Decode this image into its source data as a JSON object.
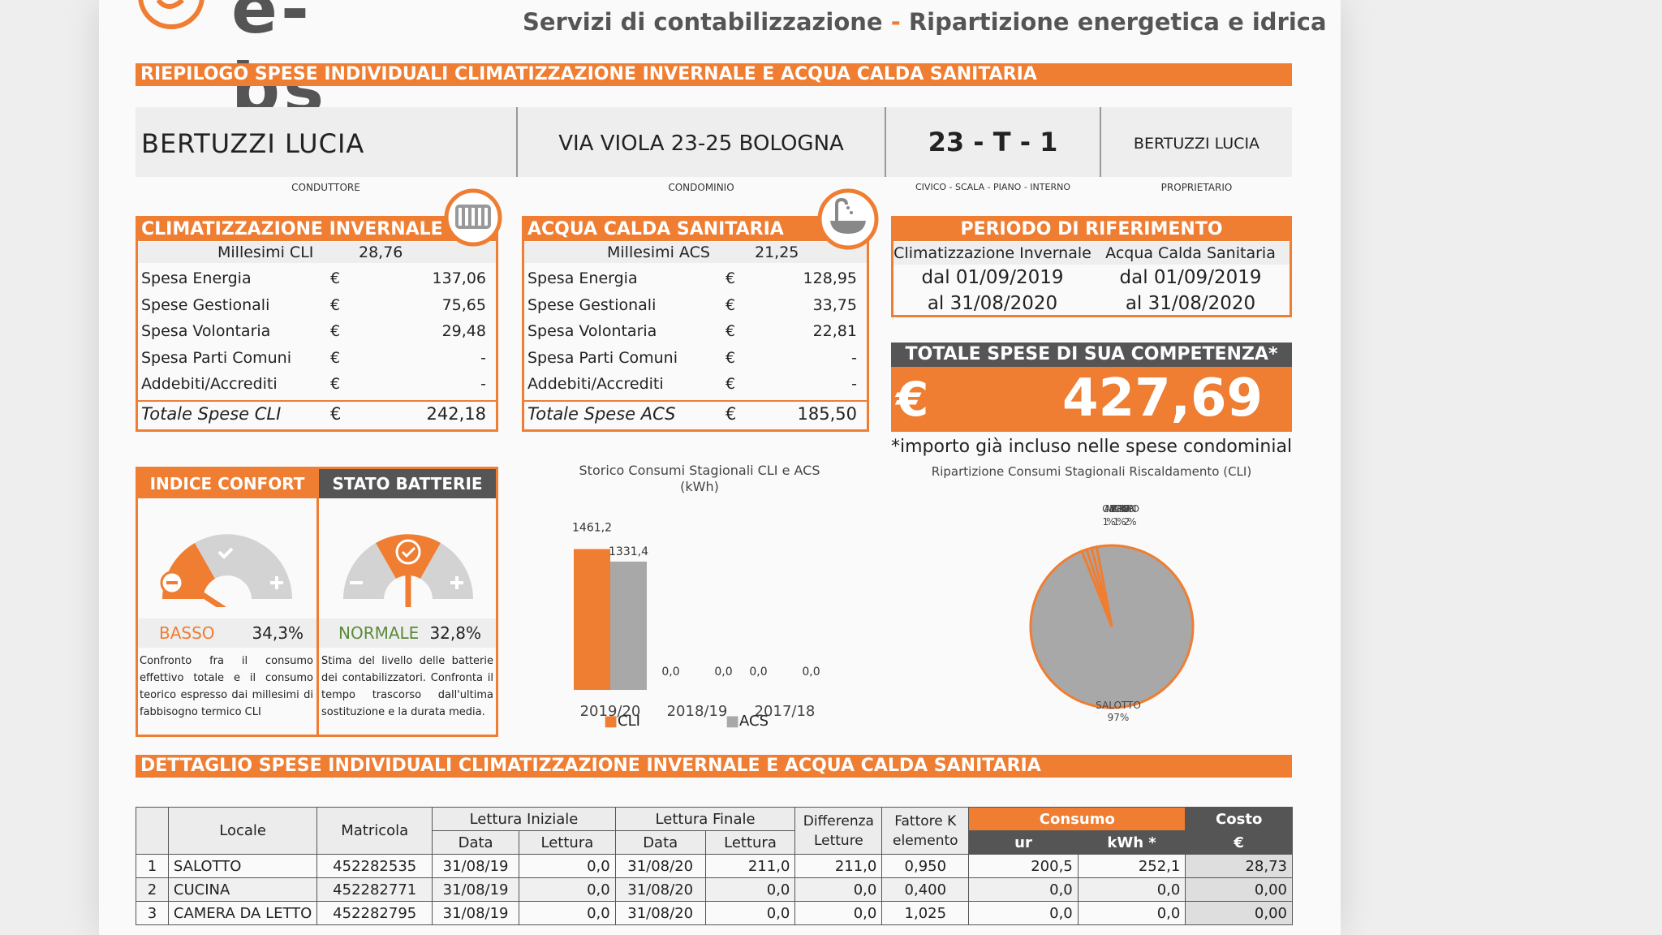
{
  "header": {
    "logo_text": "e-bs",
    "tagline_left": "Servizi di contabilizzazione",
    "tagline_sep": "-",
    "tagline_right": "Ripartizione energetica e idrica"
  },
  "summary_band": "RIEPILOGO SPESE INDIVIDUALI CLIMATIZZAZIONE INVERNALE E ACQUA CALDA SANITARIA",
  "info": {
    "tenant": "BERTUZZI LUCIA",
    "tenant_label": "CONDUTTORE",
    "condo": "VIA VIOLA 23-25 BOLOGNA",
    "condo_label": "CONDOMINIO",
    "unit": "23 - T - 1",
    "unit_label": "CIVICO - SCALA - PIANO - INTERNO",
    "owner": "BERTUZZI LUCIA",
    "owner_label": "PROPRIETARIO"
  },
  "cli": {
    "title": "CLIMATIZZAZIONE INVERNALE",
    "millesimi_label": "Millesimi CLI",
    "millesimi_value": "28,76",
    "rows": [
      {
        "label": "Spesa Energia",
        "cur": "€",
        "value": "137,06"
      },
      {
        "label": "Spese Gestionali",
        "cur": "€",
        "value": "75,65"
      },
      {
        "label": "Spesa Volontaria",
        "cur": "€",
        "value": "29,48"
      },
      {
        "label": "Spesa Parti Comuni",
        "cur": "€",
        "value": "-"
      },
      {
        "label": "Addebiti/Accrediti",
        "cur": "€",
        "value": "-"
      }
    ],
    "total_label": "Totale Spese CLI",
    "total_cur": "€",
    "total_value": "242,18"
  },
  "acs": {
    "title": "ACQUA CALDA SANITARIA",
    "millesimi_label": "Millesimi ACS",
    "millesimi_value": "21,25",
    "rows": [
      {
        "label": "Spesa Energia",
        "cur": "€",
        "value": "128,95"
      },
      {
        "label": "Spese Gestionali",
        "cur": "€",
        "value": "33,75"
      },
      {
        "label": "Spesa Volontaria",
        "cur": "€",
        "value": "22,81"
      },
      {
        "label": "Spesa Parti Comuni",
        "cur": "€",
        "value": "-"
      },
      {
        "label": "Addebiti/Accrediti",
        "cur": "€",
        "value": "-"
      }
    ],
    "total_label": "Totale Spese ACS",
    "total_cur": "€",
    "total_value": "185,50"
  },
  "period": {
    "title": "PERIODO DI RIFERIMENTO",
    "col1": "Climatizzazione Invernale",
    "col2": "Acqua Calda Sanitaria",
    "from1": "dal 01/09/2019",
    "from2": "dal 01/09/2019",
    "to1": "al 31/08/2020",
    "to2": "al 31/08/2020"
  },
  "total": {
    "title": "TOTALE SPESE DI SUA COMPETENZA*",
    "currency": "€",
    "value": "427,69",
    "note": "*importo già incluso nelle spese condominiali"
  },
  "confort": {
    "title": "INDICE CONFORT",
    "status": "BASSO",
    "percent": "34,3%",
    "description": "Confronto fra il consumo effettivo totale e il consumo teorico espresso dai millesimi di fabbisogno termico CLI",
    "status_color": "#ef7d32"
  },
  "batterie": {
    "title": "STATO BATTERIE",
    "status": "NORMALE",
    "percent": "32,8%",
    "description": "Stima del livello delle batterie dei contabilizzatori. Confronta il tempo trascorso dall'ultima sostituzione e la durata media.",
    "status_color": "#5b8a3a"
  },
  "colors": {
    "accent": "#ef7d32",
    "grey": "#a8a8a8",
    "dark": "#555555"
  },
  "icons": {
    "cli": "radiator-icon",
    "acs": "bathtub-icon"
  },
  "chart_data": [
    {
      "type": "bar",
      "title": "Storico Consumi Stagionali CLI e ACS",
      "subtitle": "(kWh)",
      "categories": [
        "2019/20",
        "2018/19",
        "2017/18"
      ],
      "series": [
        {
          "name": "CLI",
          "values": [
            1461.2,
            0.0,
            0.0
          ],
          "labels": [
            "1461,2",
            "0,0",
            "0,0"
          ],
          "color": "#ef7d32"
        },
        {
          "name": "ACS",
          "values": [
            1331.4,
            0.0,
            0.0
          ],
          "labels": [
            "1331,4",
            "0,0",
            "0,0"
          ],
          "color": "#a8a8a8"
        }
      ],
      "ylim": [
        0,
        1600
      ],
      "grid": false,
      "legend": "bottom"
    },
    {
      "type": "pie",
      "title": "Ripartizione Consumi Stagionali Riscaldamento (CLI)",
      "slices": [
        {
          "label": "SALOTTO",
          "value": 97,
          "pct": "97%",
          "color": "#a8a8a8"
        },
        {
          "label": "CAMERA",
          "value": 1,
          "pct": "1%",
          "color": "#a8a8a8"
        },
        {
          "label": "BAGNO",
          "value": 1,
          "pct": "1%",
          "color": "#a8a8a8"
        },
        {
          "label": "CORRIDOIO",
          "value": 1,
          "pct": "2%",
          "color": "#a8a8a8"
        }
      ],
      "top_label": "CAMERA CORRIDOIO BAGNO",
      "top_pct": "1%1%2%"
    }
  ],
  "detail_band": "DETTAGLIO SPESE INDIVIDUALI CLIMATIZZAZIONE INVERNALE E ACQUA CALDA SANITARIA",
  "detail": {
    "headers": {
      "locale": "Locale",
      "matricola": "Matricola",
      "lettura_iniziale": "Lettura Iniziale",
      "lettura_finale": "Lettura Finale",
      "data": "Data",
      "lettura": "Lettura",
      "differenza": "Differenza Letture",
      "fattore": "Fattore K elemento",
      "consumo": "Consumo",
      "costo": "Costo",
      "ur": "ur",
      "kwh": "kWh *",
      "euro": "€"
    },
    "rows": [
      {
        "n": "1",
        "locale": "SALOTTO",
        "matricola": "452282535",
        "d1": "31/08/19",
        "l1": "0,0",
        "d2": "31/08/20",
        "l2": "211,0",
        "diff": "211,0",
        "k": "0,950",
        "ur": "200,5",
        "kwh": "252,1",
        "costo": "28,73"
      },
      {
        "n": "2",
        "locale": "CUCINA",
        "matricola": "452282771",
        "d1": "31/08/19",
        "l1": "0,0",
        "d2": "31/08/20",
        "l2": "0,0",
        "diff": "0,0",
        "k": "0,400",
        "ur": "0,0",
        "kwh": "0,0",
        "costo": "0,00"
      },
      {
        "n": "3",
        "locale": "CAMERA DA LETTO",
        "matricola": "452282795",
        "d1": "31/08/19",
        "l1": "0,0",
        "d2": "31/08/20",
        "l2": "0,0",
        "diff": "0,0",
        "k": "1,025",
        "ur": "0,0",
        "kwh": "0,0",
        "costo": "0,00"
      }
    ]
  }
}
